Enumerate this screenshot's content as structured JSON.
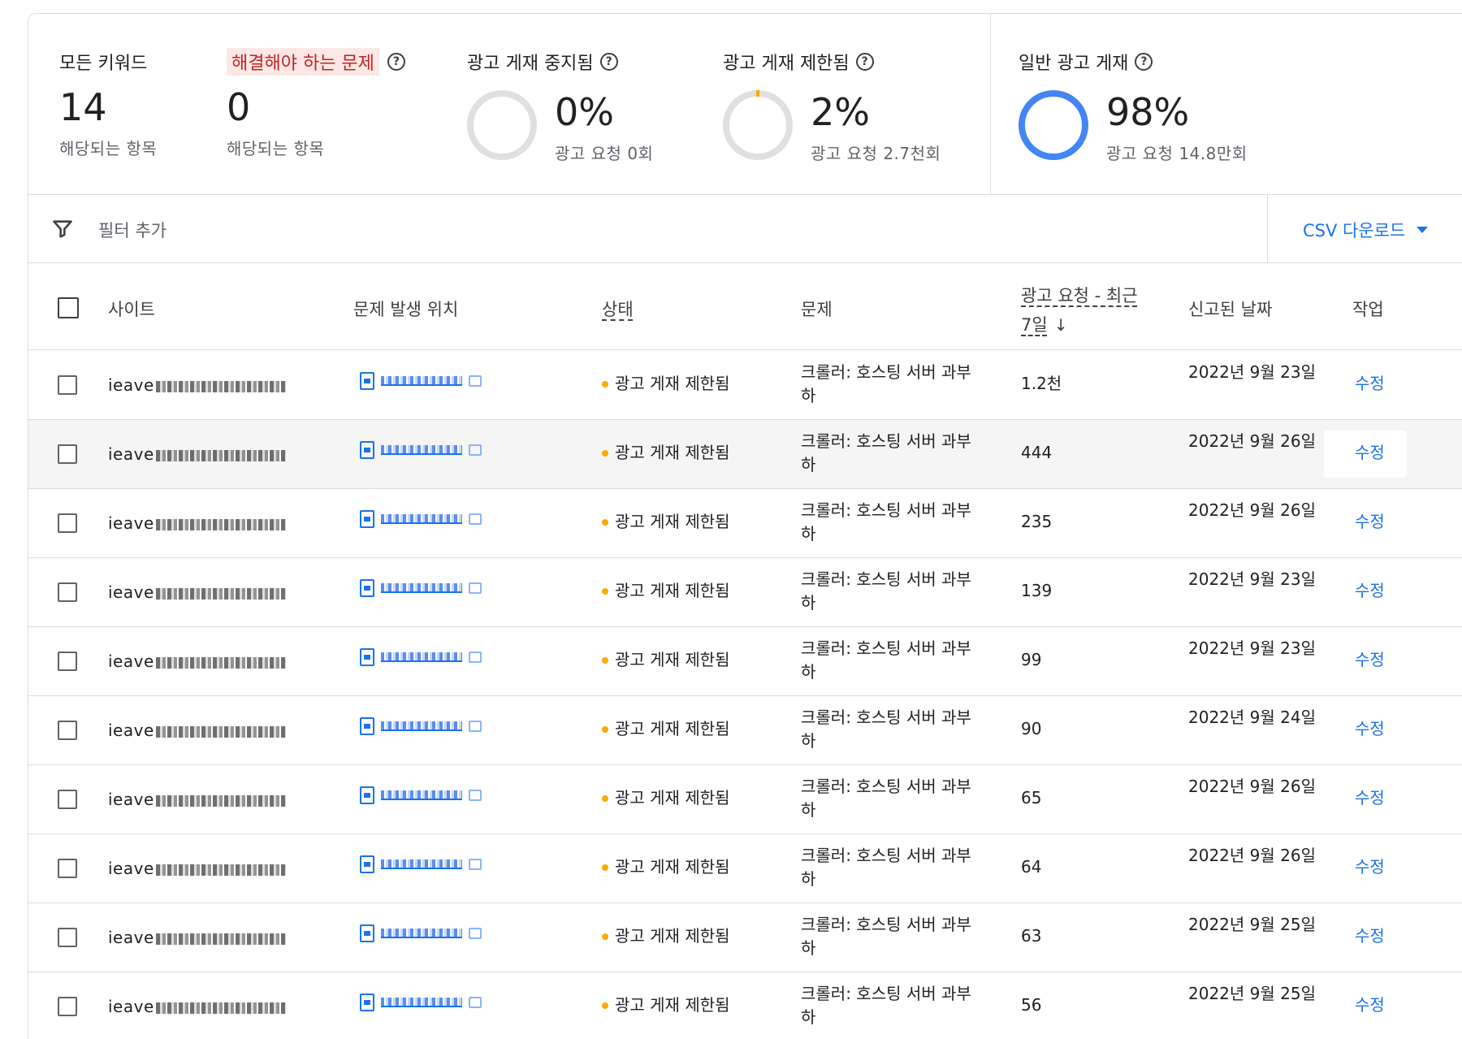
{
  "summary": {
    "all_keywords": {
      "label": "모든 키워드",
      "value": "14",
      "sub": "해당되는 항목"
    },
    "issues": {
      "label": "해결해야 하는 문제",
      "value": "0",
      "sub": "해당되는 항목"
    },
    "paused": {
      "label": "광고 게재 중지됨",
      "value": "0%",
      "sub": "광고 요청 0회"
    },
    "limited": {
      "label": "광고 게재 제한됨",
      "value": "2%",
      "sub": "광고 요청 2.7천회"
    },
    "normal": {
      "label": "일반 광고 게재",
      "value": "98%",
      "sub": "광고 요청 14.8만회"
    }
  },
  "filter": {
    "placeholder": "필터 추가",
    "csv": "CSV 다운로드"
  },
  "table": {
    "headers": {
      "site": "사이트",
      "location": "문제 발생 위치",
      "status": "상태",
      "issue": "문제",
      "requests_line1": "광고 요청 - 최근",
      "requests_line2": "7일",
      "reported": "신고된 날짜",
      "action": "작업"
    },
    "rows": [
      {
        "site": "ieave",
        "status": "광고 게재 제한됨",
        "issue": "크롤러: 호스팅 서버 과부하",
        "requests": "1.2천",
        "date": "2022년 9월 23일",
        "action": "수정"
      },
      {
        "site": "ieave",
        "status": "광고 게재 제한됨",
        "issue": "크롤러: 호스팅 서버 과부하",
        "requests": "444",
        "date": "2022년 9월 26일",
        "action": "수정"
      },
      {
        "site": "ieave",
        "status": "광고 게재 제한됨",
        "issue": "크롤러: 호스팅 서버 과부하",
        "requests": "235",
        "date": "2022년 9월 26일",
        "action": "수정"
      },
      {
        "site": "ieave",
        "status": "광고 게재 제한됨",
        "issue": "크롤러: 호스팅 서버 과부하",
        "requests": "139",
        "date": "2022년 9월 23일",
        "action": "수정"
      },
      {
        "site": "ieave",
        "status": "광고 게재 제한됨",
        "issue": "크롤러: 호스팅 서버 과부하",
        "requests": "99",
        "date": "2022년 9월 23일",
        "action": "수정"
      },
      {
        "site": "ieave",
        "status": "광고 게재 제한됨",
        "issue": "크롤러: 호스팅 서버 과부하",
        "requests": "90",
        "date": "2022년 9월 24일",
        "action": "수정"
      },
      {
        "site": "ieave",
        "status": "광고 게재 제한됨",
        "issue": "크롤러: 호스팅 서버 과부하",
        "requests": "65",
        "date": "2022년 9월 26일",
        "action": "수정"
      },
      {
        "site": "ieave",
        "status": "광고 게재 제한됨",
        "issue": "크롤러: 호스팅 서버 과부하",
        "requests": "64",
        "date": "2022년 9월 26일",
        "action": "수정"
      },
      {
        "site": "ieave",
        "status": "광고 게재 제한됨",
        "issue": "크롤러: 호스팅 서버 과부하",
        "requests": "63",
        "date": "2022년 9월 25일",
        "action": "수정"
      },
      {
        "site": "ieave",
        "status": "광고 게재 제한됨",
        "issue": "크롤러: 호스팅 서버 과부하",
        "requests": "56",
        "date": "2022년 9월 25일",
        "action": "수정"
      }
    ]
  },
  "colors": {
    "accent": "#1a73e8",
    "status_dot": "#f9ab00",
    "ring_fill": "#4285f4",
    "issue_bg": "#fce8e6"
  },
  "ring_levels": {
    "paused": 0,
    "limited": 0.02,
    "normal": 0.98
  }
}
